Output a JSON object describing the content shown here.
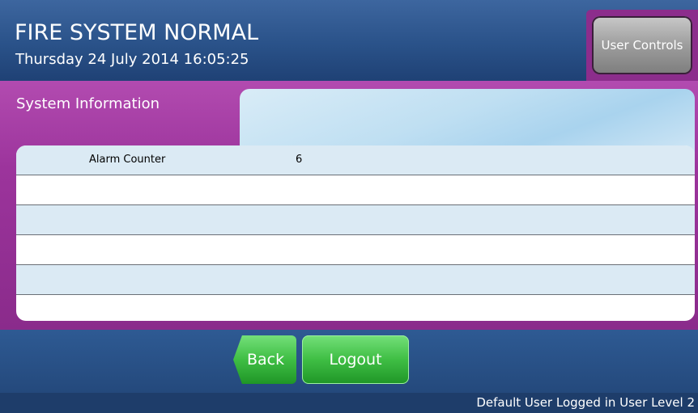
{
  "header": {
    "status": "FIRE SYSTEM NORMAL",
    "datetime": "Thursday 24 July 2014 16:05:25",
    "user_controls_label": "User Controls"
  },
  "panel": {
    "title": "System Information",
    "rows": [
      {
        "label": "Alarm Counter",
        "value": "6"
      },
      {
        "label": "",
        "value": ""
      },
      {
        "label": "",
        "value": ""
      },
      {
        "label": "",
        "value": ""
      },
      {
        "label": "",
        "value": ""
      },
      {
        "label": "",
        "value": ""
      }
    ]
  },
  "nav": {
    "back_label": "Back",
    "logout_label": "Logout"
  },
  "footer": {
    "status_text": "Default User Logged in User Level 2"
  },
  "colors": {
    "header_blue": "#2a5289",
    "panel_purple": "#9c349c",
    "button_green": "#3fbe44",
    "row_alt": "#dbeaf4"
  }
}
